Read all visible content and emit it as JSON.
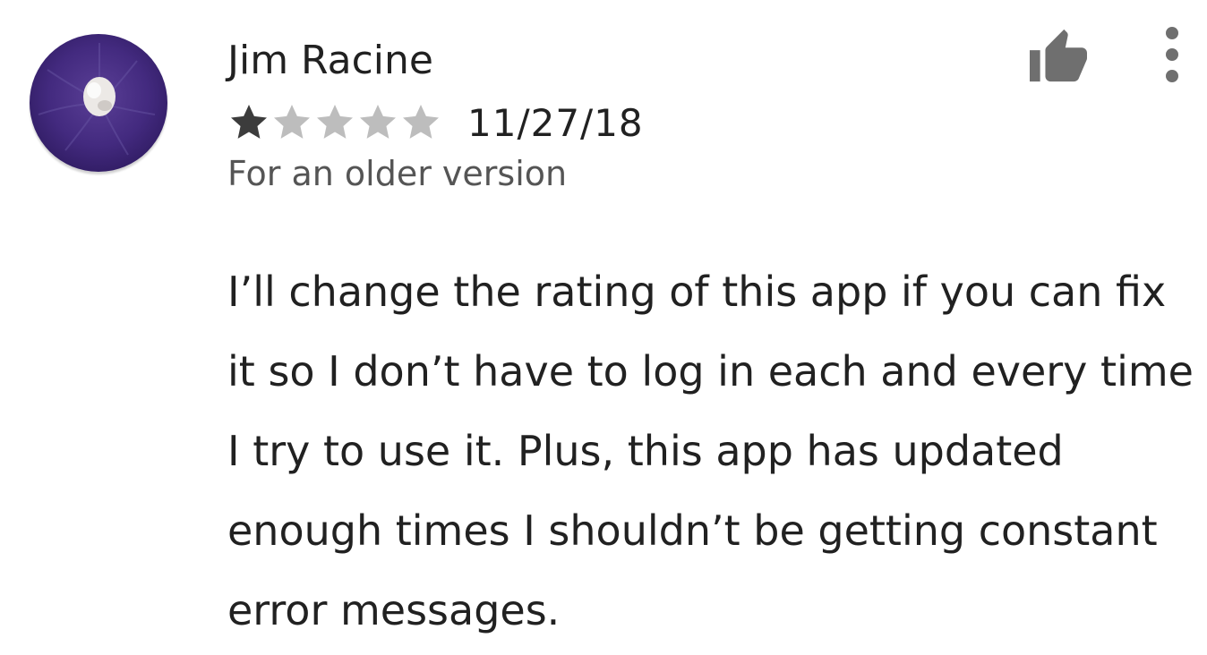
{
  "review": {
    "author": "Jim Racine",
    "rating": 1,
    "rating_max": 5,
    "date": "11/27/18",
    "version_note": "For an older version",
    "body": "I’ll change the rating of this app if you can fix it so I don’t have to log in each and every time I try to use it. Plus, this app has updated enough times I shouldn’t be getting constant error messages."
  },
  "icons": {
    "avatar": "avatar-image",
    "helpful": "thumbs-up-icon",
    "menu": "more-vert-icon",
    "star": "star-icon"
  },
  "colors": {
    "star_filled": "#3c3c3c",
    "star_empty": "#bdbdbd",
    "icon": "#6f6f6f",
    "avatar_bg": "#3e2576"
  }
}
